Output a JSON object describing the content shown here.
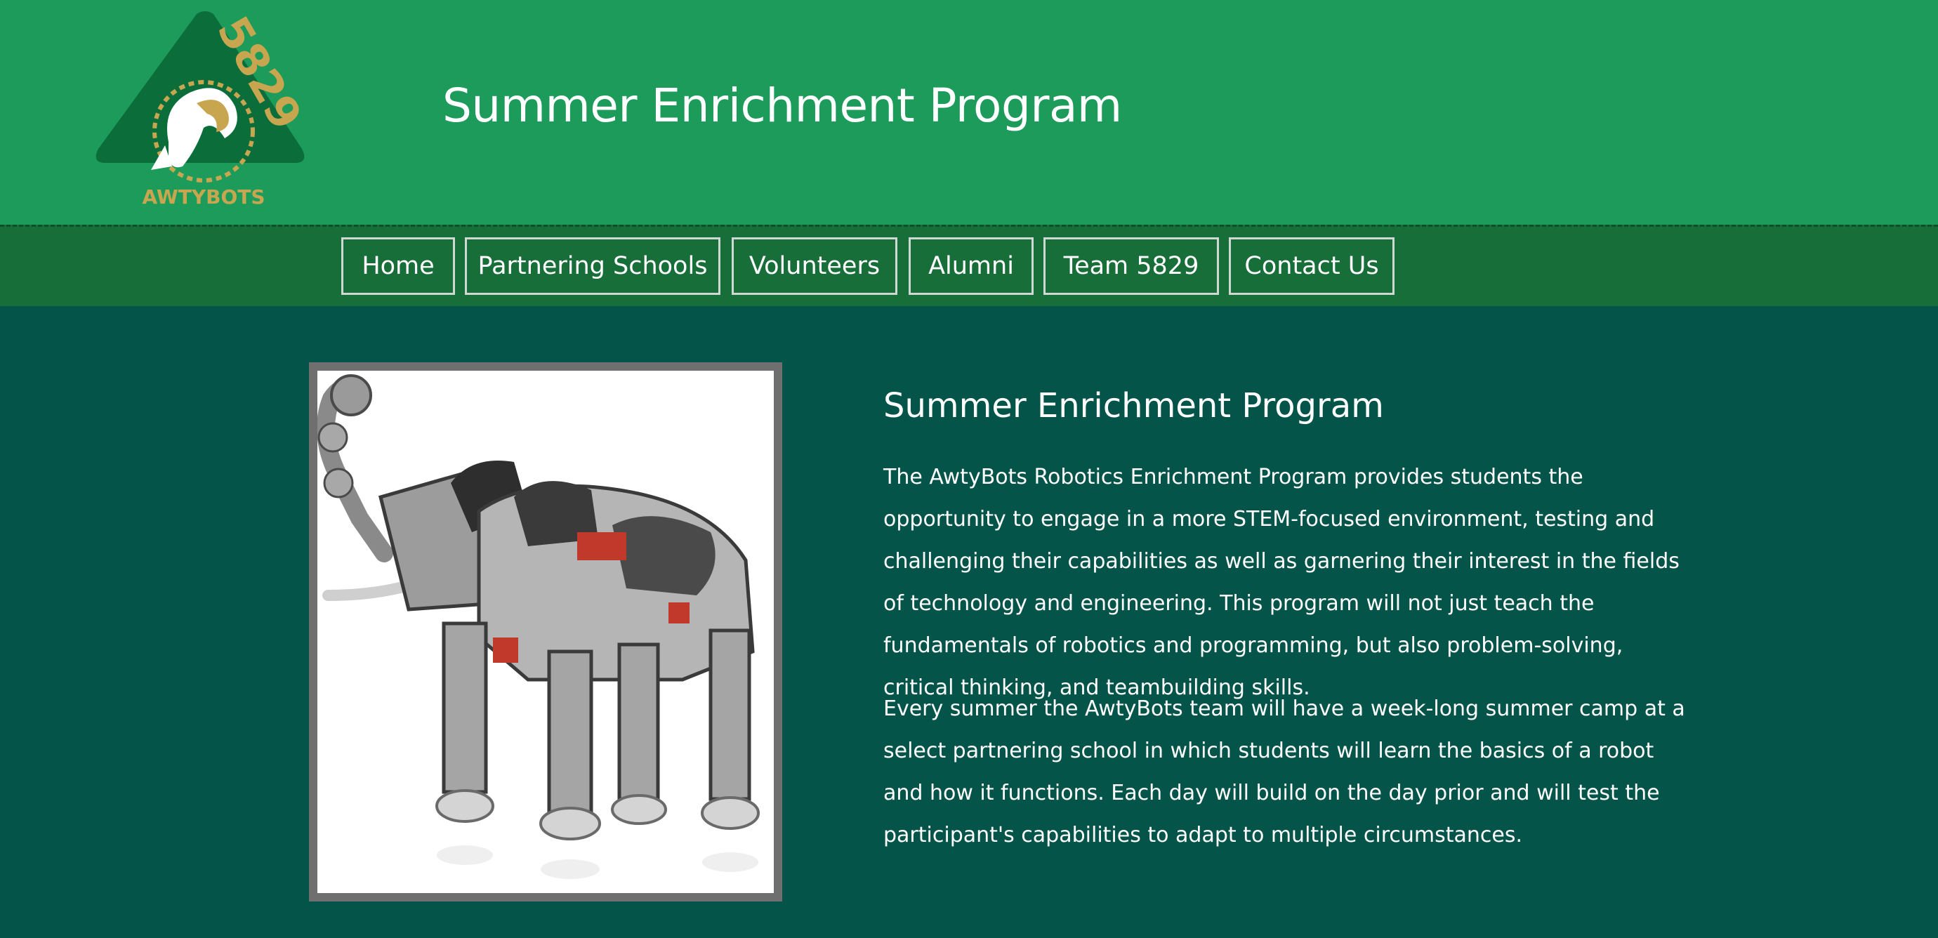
{
  "header": {
    "logo_team_number": "5829",
    "logo_wordmark": "AWTYBOTS",
    "site_title": "Summer Enrichment Program"
  },
  "nav": {
    "items": [
      {
        "label": "Home"
      },
      {
        "label": "Partnering Schools"
      },
      {
        "label": "Volunteers"
      },
      {
        "label": "Alumni"
      },
      {
        "label": "Team 5829"
      },
      {
        "label": "Contact Us"
      }
    ]
  },
  "main": {
    "image_alt": "robot-elephant-image",
    "title": "Summer Enrichment Program",
    "paragraphs": [
      "The AwtyBots Robotics Enrichment Program provides students the opportunity to engage in a more STEM-focused environment, testing and challenging their capabilities as well as garnering their interest in the fields of technology and engineering. This program will not just teach the fundamentals of robotics and programming, but also problem-solving, critical thinking, and teambuilding skills.",
      "Every summer the AwtyBots team will have a week-long summer camp at a select partnering school in which students will learn the basics of a robot and how it functions. Each day will build on the day prior and will test the participant's capabilities to adapt to multiple circumstances."
    ]
  },
  "colors": {
    "header_bg": "#1d9b5a",
    "nav_bg": "#176e39",
    "body_bg": "#05544a",
    "logo_green": "#0b6e3a",
    "logo_gold": "#c8a650"
  }
}
